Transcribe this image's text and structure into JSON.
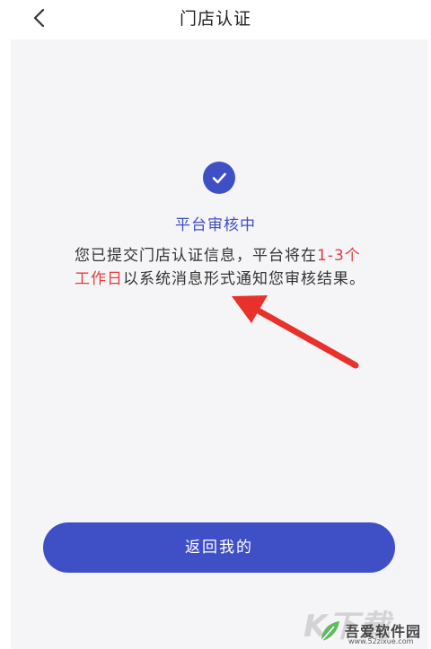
{
  "header": {
    "title": "门店认证",
    "back_icon": "chevron-left-icon"
  },
  "status": {
    "icon": "check-circle-icon",
    "title": "平台审核中",
    "message_part1": "您已提交门店认证信息，平台将在",
    "message_highlight": "1-3个工作日",
    "message_part2": "以系统消息形式通知您审核结果。"
  },
  "actions": {
    "return_label": "返回我的"
  },
  "watermark": {
    "big_text": "K下载",
    "site_name": "吾爱软件园",
    "url": "www.52zixue.com"
  },
  "colors": {
    "accent": "#3f4fc6",
    "highlight": "#e63b3b",
    "panel_bg": "#f5f5f7",
    "arrow": "#e8312a"
  }
}
